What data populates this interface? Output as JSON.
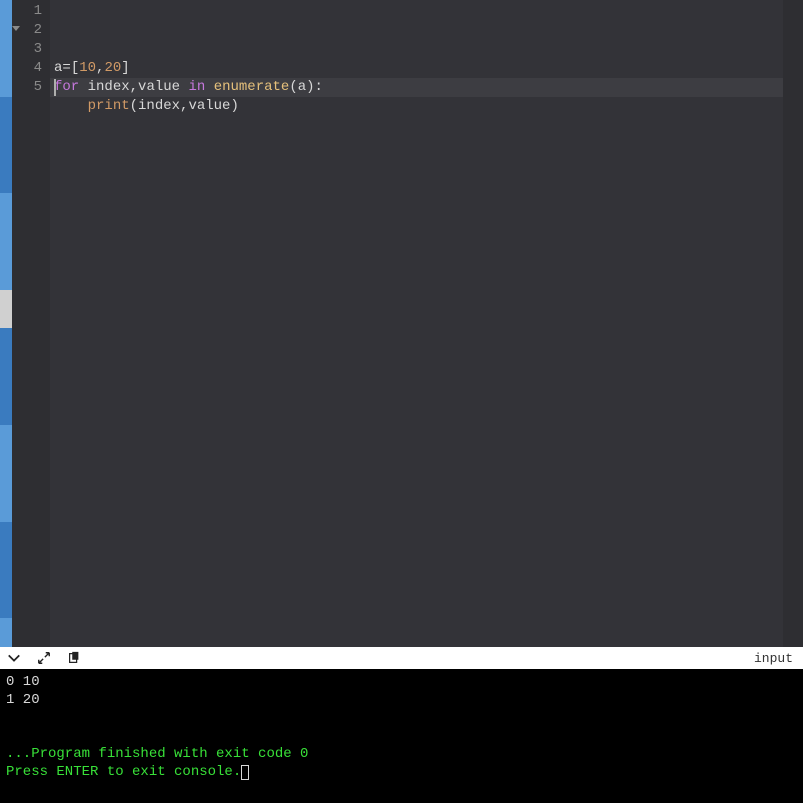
{
  "editor": {
    "language": "python",
    "active_line": 5,
    "fold_line": 2,
    "lines": [
      {
        "num": "1",
        "tokens": [
          {
            "t": "a",
            "c": "tok-id"
          },
          {
            "t": "=",
            "c": "tok-op"
          },
          {
            "t": "[",
            "c": "tok-op"
          },
          {
            "t": "10",
            "c": "tok-num"
          },
          {
            "t": ",",
            "c": "tok-op"
          },
          {
            "t": "20",
            "c": "tok-num"
          },
          {
            "t": "]",
            "c": "tok-op"
          }
        ]
      },
      {
        "num": "2",
        "tokens": [
          {
            "t": "for",
            "c": "tok-kw"
          },
          {
            "t": " ",
            "c": ""
          },
          {
            "t": "index",
            "c": "tok-id"
          },
          {
            "t": ",",
            "c": "tok-op"
          },
          {
            "t": "value",
            "c": "tok-id"
          },
          {
            "t": " ",
            "c": ""
          },
          {
            "t": "in",
            "c": "tok-kw2"
          },
          {
            "t": " ",
            "c": ""
          },
          {
            "t": "enumerate",
            "c": "tok-call"
          },
          {
            "t": "(",
            "c": "tok-op"
          },
          {
            "t": "a",
            "c": "tok-id"
          },
          {
            "t": ")",
            "c": "tok-op"
          },
          {
            "t": ":",
            "c": "tok-op"
          }
        ]
      },
      {
        "num": "3",
        "tokens": [
          {
            "t": "    ",
            "c": ""
          },
          {
            "t": "print",
            "c": "tok-fn"
          },
          {
            "t": "(",
            "c": "tok-op"
          },
          {
            "t": "index",
            "c": "tok-id"
          },
          {
            "t": ",",
            "c": "tok-op"
          },
          {
            "t": "value",
            "c": "tok-id"
          },
          {
            "t": ")",
            "c": "tok-op"
          }
        ]
      },
      {
        "num": "4",
        "tokens": []
      },
      {
        "num": "5",
        "tokens": []
      }
    ]
  },
  "toolbar": {
    "right_label": "input"
  },
  "console": {
    "output": "0 10\n1 20",
    "finish_line1": "...Program finished with exit code 0",
    "finish_line2": "Press ENTER to exit console."
  }
}
